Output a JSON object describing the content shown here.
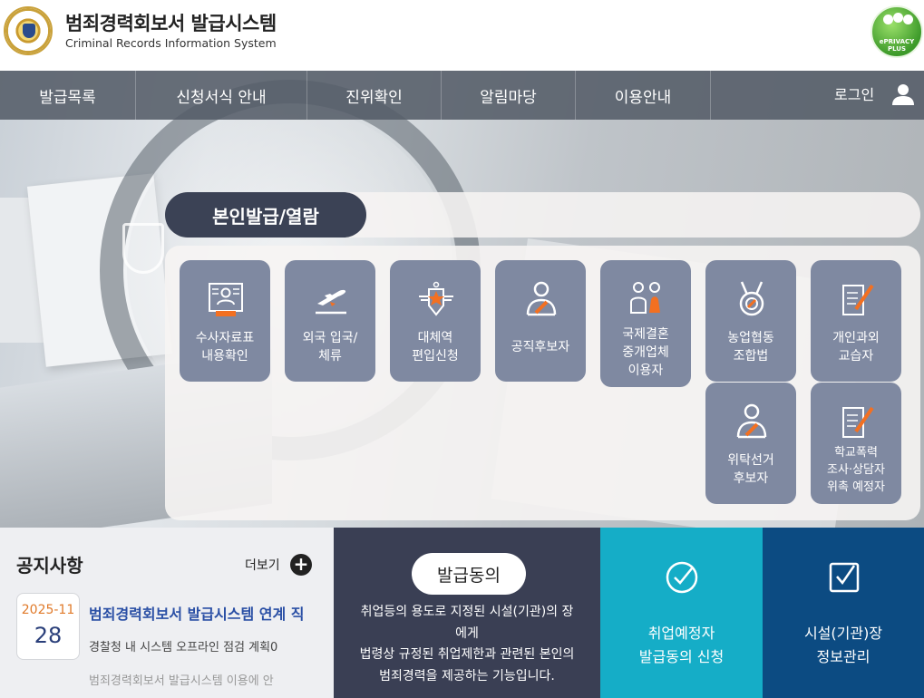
{
  "header": {
    "title": "범죄경력회보서 발급시스템",
    "subtitle": "Criminal Records Information System",
    "badge": "ePRIVACY PLUS"
  },
  "nav": {
    "items": [
      {
        "label": "발급목록"
      },
      {
        "label": "신청서식 안내"
      },
      {
        "label": "진위확인"
      },
      {
        "label": "알림마당"
      },
      {
        "label": "이용안내"
      }
    ],
    "login_label": "로그인"
  },
  "section": {
    "title": "본인발급/열람"
  },
  "tiles": [
    {
      "label_lines": [
        "수사자료표",
        "내용확인"
      ],
      "icon": "id-card-icon"
    },
    {
      "label_lines": [
        "외국 입국/",
        "체류"
      ],
      "icon": "airplane-icon"
    },
    {
      "label_lines": [
        "대체역",
        "편입신청"
      ],
      "icon": "military-emblem-icon"
    },
    {
      "label_lines": [
        "공직후보자"
      ],
      "icon": "person-sash-icon"
    },
    {
      "label_lines": [
        "국제결혼",
        "중개업체",
        "이용자"
      ],
      "icon": "couple-icon"
    },
    {
      "label_lines": [
        "농업협동",
        "조합법"
      ],
      "icon": "medal-icon"
    },
    {
      "label_lines": [
        "개인과외",
        "교습자"
      ],
      "icon": "document-pen-icon"
    },
    {
      "label_lines": [
        "위탁선거",
        "후보자"
      ],
      "icon": "person-sash-icon"
    },
    {
      "label_lines": [
        "학교폭력",
        "조사·상담자",
        "위촉 예정자"
      ],
      "icon": "document-pen-icon"
    }
  ],
  "notice": {
    "title": "공지사항",
    "more_label": "더보기",
    "date_month": "2025-11",
    "date_day": "28",
    "headline": "범죄경력회보서 발급시스템 연계 직",
    "line2": "경찰청 내 시스템 오프라인 점검 계획0",
    "line3": "범죄경력회보서 발급시스템 이용에 안"
  },
  "consent": {
    "title": "발급동의",
    "desc_lines": [
      "취업등의 용도로 지정된 시설(기관)의 장",
      "에게",
      "법령상 규정된 취업제한과 관련된 본인의",
      "범죄경력을 제공하는 기능입니다."
    ]
  },
  "apply": {
    "label_lines": [
      "취업예정자",
      "발급동의 신청"
    ]
  },
  "facility": {
    "label_lines": [
      "시설(기관)장",
      "정보관리"
    ]
  },
  "colors": {
    "nav_bg": "#545c68",
    "tile_bg": "#7f89a1",
    "tile_accent": "#f37021",
    "section_pill": "#3b4255",
    "consent_bg": "#3a3f54",
    "apply_bg": "#15adc7",
    "facility_bg": "#0c4b82",
    "notice_link": "#2a4fa5",
    "date_month": "#e07a2a"
  }
}
